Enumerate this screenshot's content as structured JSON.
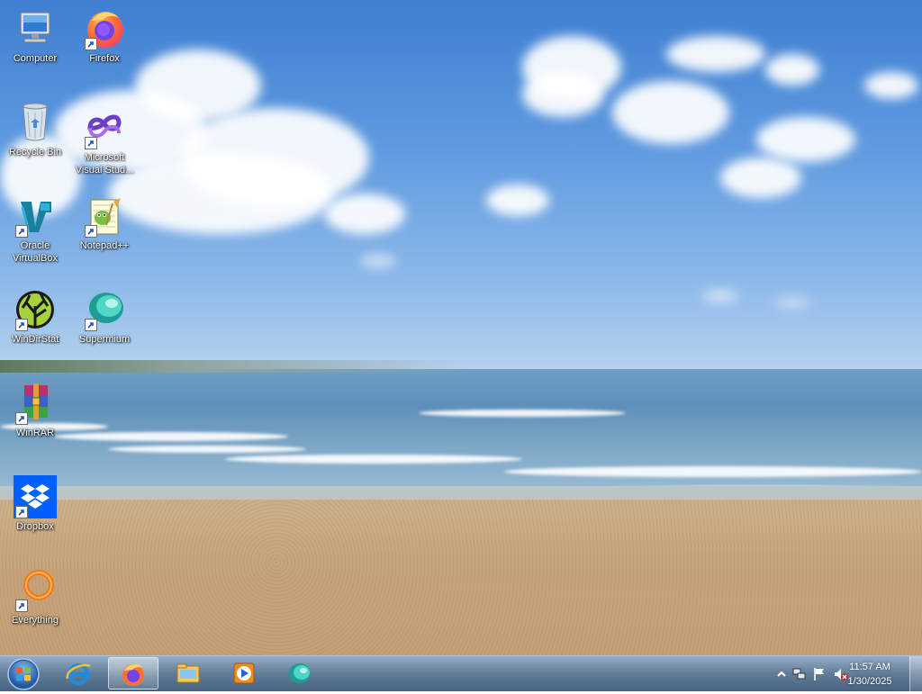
{
  "desktop": {
    "icons": [
      {
        "label": "Computer",
        "icon": "computer-icon",
        "shortcut": false
      },
      {
        "label": "Firefox",
        "icon": "firefox-icon",
        "shortcut": true
      },
      {
        "label": "Recycle Bin",
        "icon": "recycle-bin-icon",
        "shortcut": false
      },
      {
        "label": "Microsoft Visual Stud...",
        "icon": "visual-studio-icon",
        "shortcut": true
      },
      {
        "label": "Oracle VirtualBox",
        "icon": "virtualbox-icon",
        "shortcut": true
      },
      {
        "label": "Notepad++",
        "icon": "notepad-plus-plus-icon",
        "shortcut": true
      },
      {
        "label": "WinDirStat",
        "icon": "windirstat-icon",
        "shortcut": true
      },
      {
        "label": "Supermium",
        "icon": "supermium-icon",
        "shortcut": true
      },
      {
        "label": "WinRAR",
        "icon": "winrar-icon",
        "shortcut": true
      },
      {
        "label": "Dropbox",
        "icon": "dropbox-icon",
        "shortcut": true
      },
      {
        "label": "Everything",
        "icon": "everything-icon",
        "shortcut": true
      }
    ]
  },
  "taskbar": {
    "start": {
      "icon": "windows-start-icon"
    },
    "pinned": [
      {
        "icon": "internet-explorer-icon",
        "active": false
      },
      {
        "icon": "firefox-icon",
        "active": true
      },
      {
        "icon": "file-explorer-icon",
        "active": false
      },
      {
        "icon": "media-player-icon",
        "active": false
      },
      {
        "icon": "supermium-icon",
        "active": false
      }
    ],
    "tray": {
      "icons": [
        "show-hidden-icons-icon",
        "network-icon",
        "action-center-flag-icon",
        "volume-muted-icon"
      ]
    },
    "clock": {
      "time": "11:57 AM",
      "date": "1/30/2025"
    }
  },
  "colors": {
    "sky": "#4f8ad8",
    "sea": "#6f9fc6",
    "sand": "#c6a57c",
    "taskbar": "#5a7fa3"
  }
}
